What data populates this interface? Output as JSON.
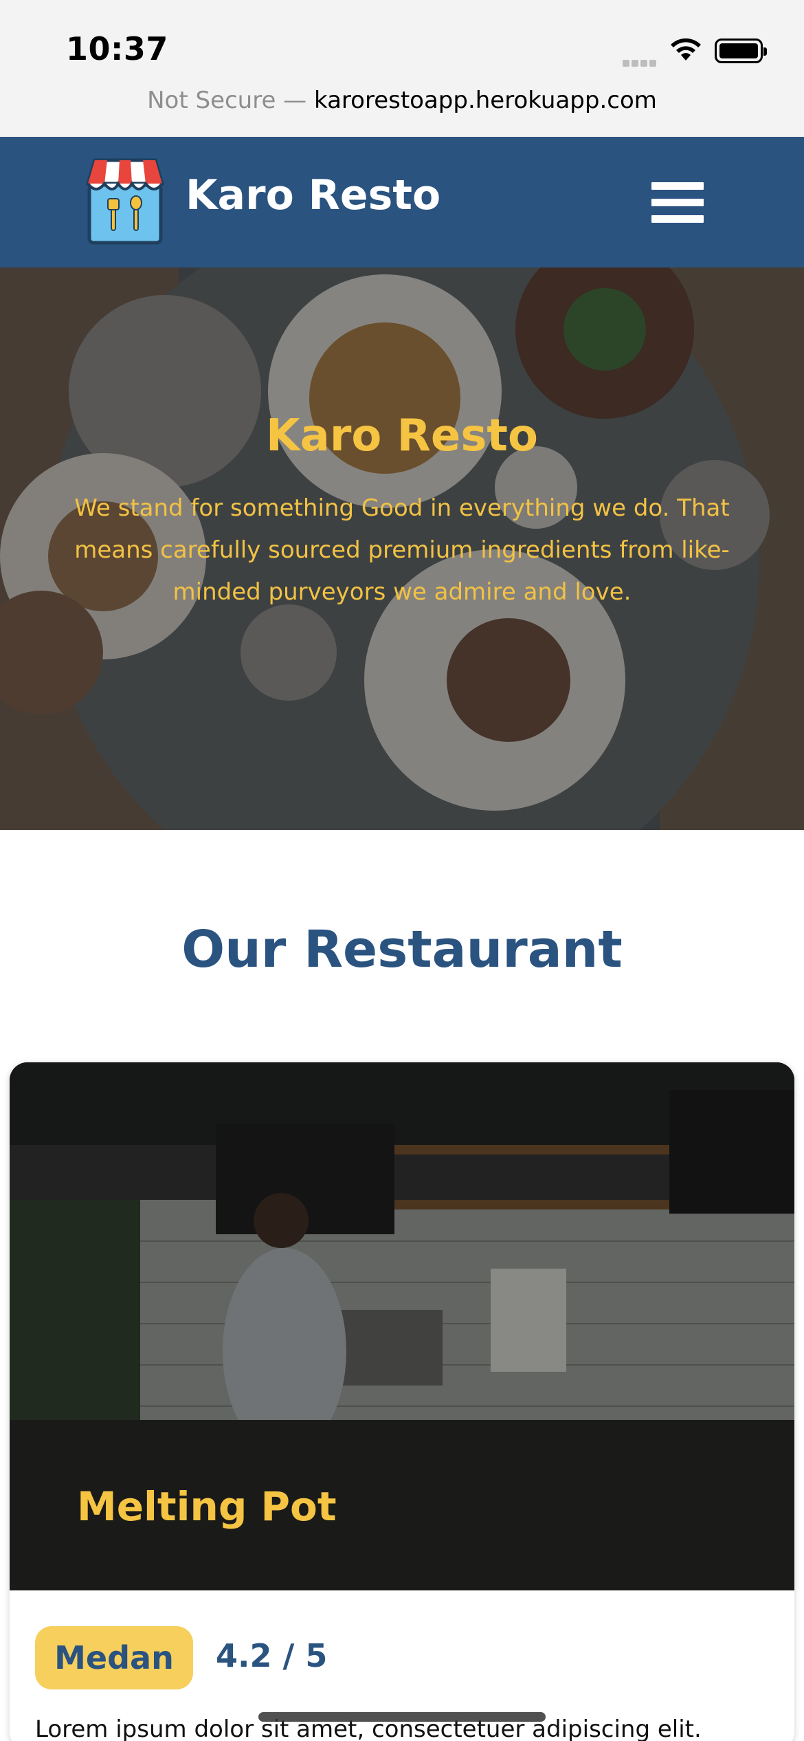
{
  "status_bar": {
    "time": "10:37",
    "url_prefix": "Not Secure — ",
    "url": "karorestoapp.herokuapp.com",
    "icons": [
      "signal-icon",
      "wifi-icon",
      "battery-icon"
    ]
  },
  "header": {
    "logo_icon": "store-icon",
    "brand": "Karo Resto",
    "menu_icon": "hamburger-menu-icon",
    "bg_color": "#2a5380"
  },
  "hero": {
    "title": "Karo Resto",
    "text": "We stand for something Good in everything we do. That means carefully sourced premium ingredients from like-minded purveyors we admire and love.",
    "accent_color": "#f6c443"
  },
  "section": {
    "title": "Our Restaurant"
  },
  "restaurants": [
    {
      "name": "Melting Pot",
      "city": "Medan",
      "rating": "4.2 / 5",
      "description": "Lorem ipsum dolor sit amet, consectetuer adipiscing elit."
    }
  ]
}
